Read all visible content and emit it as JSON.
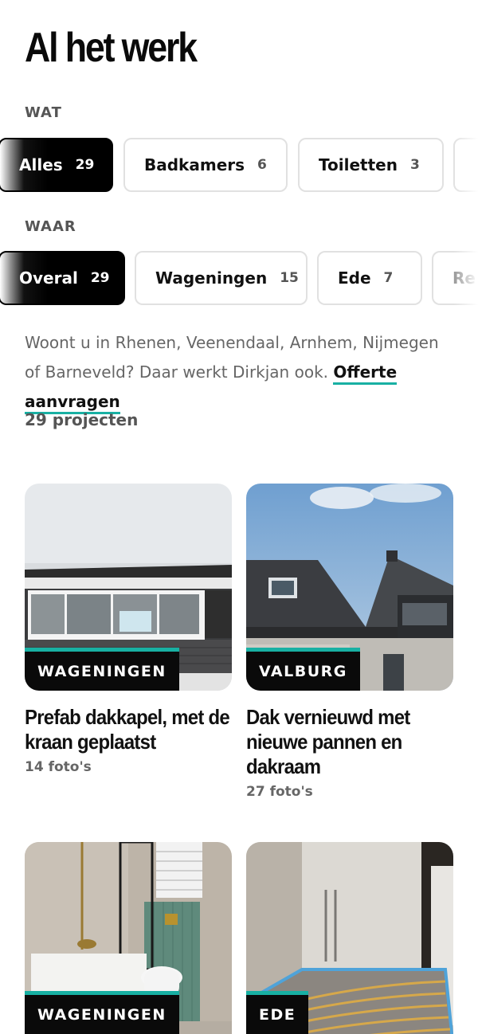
{
  "page": {
    "title": "Al het werk"
  },
  "filters": {
    "what_label": "WAT",
    "what": [
      {
        "label": "Alles",
        "count": "29"
      },
      {
        "label": "Badkamers",
        "count": "6"
      },
      {
        "label": "Toiletten",
        "count": "3"
      }
    ],
    "where_label": "WAAR",
    "where": [
      {
        "label": "Overal",
        "count": "29"
      },
      {
        "label": "Wageningen",
        "count": "15"
      },
      {
        "label": "Ede",
        "count": "7"
      },
      {
        "label": "Re",
        "count": ""
      }
    ]
  },
  "intro": {
    "text": "Woont u in Rhenen, Veenendaal, Arnhem, Nijmegen of Barneveld? Daar werkt Dirkjan ook. ",
    "link": "Offerte aanvragen"
  },
  "results": {
    "count": "29 projecten"
  },
  "projects": [
    {
      "location": "WAGENINGEN",
      "title": "Prefab dakkapel, met de kraan geplaatst",
      "photos": "14 foto's"
    },
    {
      "location": "VALBURG",
      "title": "Dak vernieuwd met nieuwe pannen en dakraam",
      "photos": "27 foto's"
    },
    {
      "location": "WAGENINGEN",
      "title": "",
      "photos": ""
    },
    {
      "location": "EDE",
      "title": "",
      "photos": ""
    }
  ],
  "colors": {
    "accent": "#18b0a3",
    "active_chip": "#000000"
  }
}
